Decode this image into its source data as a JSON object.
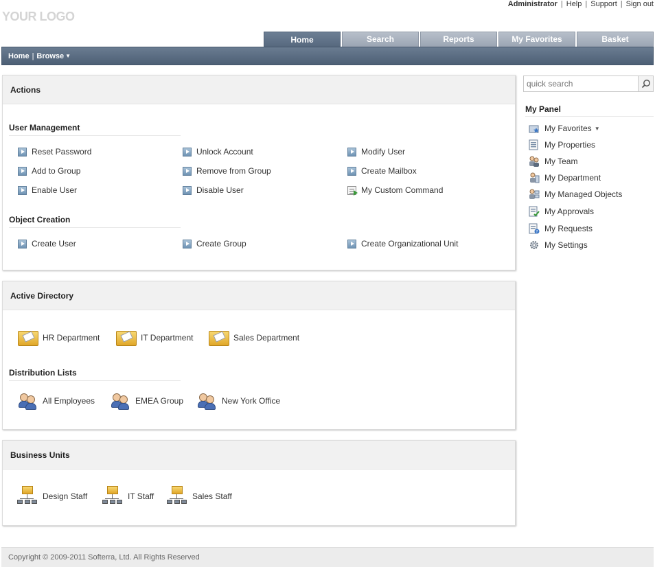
{
  "header": {
    "logo": "YOUR LOGO",
    "user": "Administrator",
    "links": [
      "Help",
      "Support",
      "Sign out"
    ]
  },
  "tabs": [
    {
      "label": "Home",
      "active": true
    },
    {
      "label": "Search",
      "active": false
    },
    {
      "label": "Reports",
      "active": false
    },
    {
      "label": "My Favorites",
      "active": false
    },
    {
      "label": "Basket",
      "active": false
    }
  ],
  "navbar": {
    "home": "Home",
    "browse": "Browse"
  },
  "actions": {
    "title": "Actions",
    "user_management": {
      "title": "User Management",
      "items": [
        "Reset Password",
        "Unlock Account",
        "Modify User",
        "Add to Group",
        "Remove from Group",
        "Create Mailbox",
        "Enable User",
        "Disable User",
        "My Custom Command"
      ]
    },
    "object_creation": {
      "title": "Object Creation",
      "items": [
        "Create User",
        "Create Group",
        "Create Organizational Unit"
      ]
    }
  },
  "active_directory": {
    "title": "Active Directory",
    "folders": [
      "HR Department",
      "IT Department",
      "Sales Department"
    ],
    "distribution_lists": {
      "title": "Distribution Lists",
      "items": [
        "All Employees",
        "EMEA Group",
        "New York Office"
      ]
    }
  },
  "business_units": {
    "title": "Business Units",
    "items": [
      "Design Staff",
      "IT Staff",
      "Sales Staff"
    ]
  },
  "search": {
    "placeholder": "quick search"
  },
  "my_panel": {
    "title": "My Panel",
    "items": [
      "My Favorites",
      "My Properties",
      "My Team",
      "My Department",
      "My Managed Objects",
      "My Approvals",
      "My Requests",
      "My Settings"
    ]
  },
  "footer": {
    "copyright": "Copyright © 2009-2011 Softerra, Ltd. All Rights Reserved"
  }
}
